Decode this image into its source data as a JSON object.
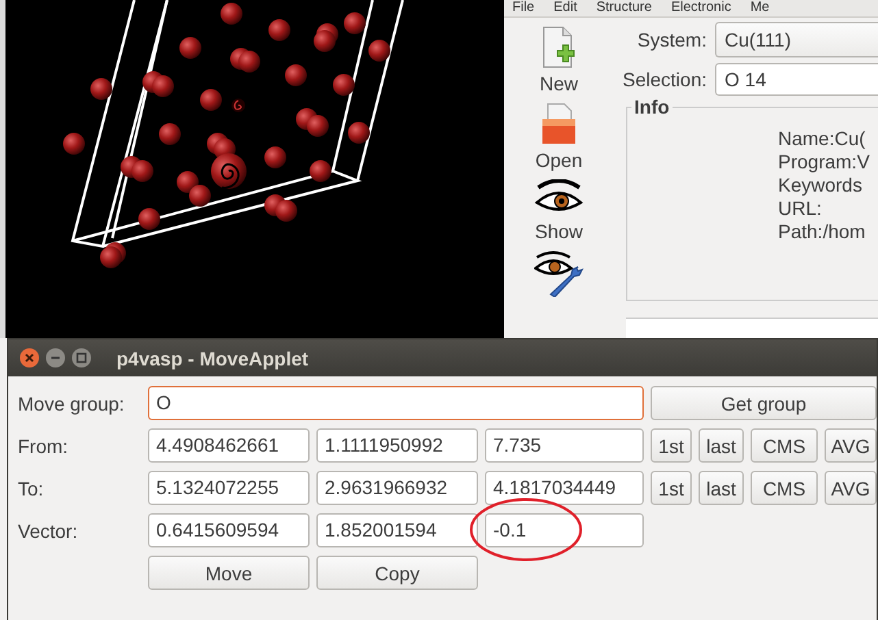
{
  "menu": [
    "File",
    "Edit",
    "Structure",
    "Electronic",
    "Me"
  ],
  "toolbar": [
    {
      "kind": "new",
      "label": "New"
    },
    {
      "kind": "open",
      "label": "Open"
    },
    {
      "kind": "show",
      "label": "Show"
    },
    {
      "kind": "edit"
    }
  ],
  "system": {
    "label": "System:",
    "value": "Cu(111)"
  },
  "selection": {
    "label": "Selection:",
    "value": "O 14"
  },
  "info": {
    "title": "Info",
    "lines": [
      "Name:Cu(",
      "Program:V",
      "Keywords",
      "URL:",
      "Path:/hom"
    ]
  },
  "dialog": {
    "title": "p4vasp - MoveApplet",
    "move_group": {
      "label": "Move group:",
      "value": "O",
      "focused": true,
      "button": "Get group"
    },
    "rows": [
      {
        "label": "From:",
        "values": [
          {
            "text": "4.4908462661",
            "circled": false
          },
          {
            "text": "1.1111950992",
            "circled": false
          },
          {
            "text": "7.735",
            "circled": false
          }
        ],
        "buttons": [
          "1st",
          "last",
          "CMS",
          "AVG"
        ]
      },
      {
        "label": "To:",
        "values": [
          {
            "text": "5.1324072255",
            "circled": false
          },
          {
            "text": "2.9631966932",
            "circled": false
          },
          {
            "text": "4.1817034449",
            "circled": false
          }
        ],
        "buttons": [
          "1st",
          "last",
          "CMS",
          "AVG"
        ]
      },
      {
        "label": "Vector:",
        "values": [
          {
            "text": "0.6415609594",
            "circled": false
          },
          {
            "text": "1.852001594",
            "circled": false
          },
          {
            "text": "-0.1",
            "circled": true
          }
        ]
      }
    ],
    "actions": [
      "Move",
      "Copy"
    ]
  }
}
